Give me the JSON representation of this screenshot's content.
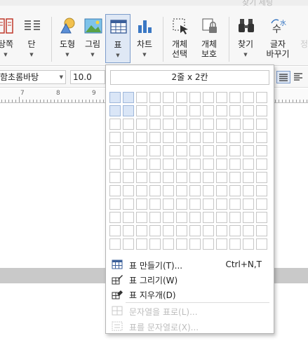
{
  "ribbon": {
    "top_hint": "찾기 세팅",
    "buttons": [
      {
        "label": "탕쪽",
        "icon": "page-layout-icon"
      },
      {
        "label": "단",
        "icon": "columns-icon"
      },
      {
        "label": "도형",
        "icon": "shapes-icon"
      },
      {
        "label": "그림",
        "icon": "picture-icon"
      },
      {
        "label": "표",
        "icon": "table-icon"
      },
      {
        "label": "차트",
        "icon": "chart-icon"
      },
      {
        "label": "개체\n선택",
        "icon": "select-object-icon"
      },
      {
        "label": "개체\n보호",
        "icon": "lock-object-icon"
      },
      {
        "label": "찾기",
        "icon": "binoculars-icon"
      },
      {
        "label": "글자\n바꾸기",
        "icon": "replace-char-icon"
      },
      {
        "label": "정",
        "icon": "more-icon"
      }
    ]
  },
  "format_bar": {
    "font_name": "함초롬바탕",
    "font_size": "10.0"
  },
  "ruler": {
    "numbers": [
      "7",
      "8",
      "9"
    ]
  },
  "table_menu": {
    "size_label": "2줄 x 2칸",
    "rows": 12,
    "cols": 12,
    "selected_rows": 2,
    "selected_cols": 2,
    "items": [
      {
        "label": "표 만들기(T)...",
        "shortcut": "Ctrl+N,T",
        "icon": "table-create-icon",
        "enabled": true
      },
      {
        "label": "표 그리기(W)",
        "shortcut": "",
        "icon": "table-draw-icon",
        "enabled": true
      },
      {
        "label": "표 지우개(D)",
        "shortcut": "",
        "icon": "table-eraser-icon",
        "enabled": true
      },
      {
        "label": "문자열을 표로(L)...",
        "shortcut": "",
        "icon": "text-to-table-icon",
        "enabled": false
      },
      {
        "label": "표를 문자열로(X)...",
        "shortcut": "",
        "icon": "table-to-text-icon",
        "enabled": false
      }
    ]
  }
}
